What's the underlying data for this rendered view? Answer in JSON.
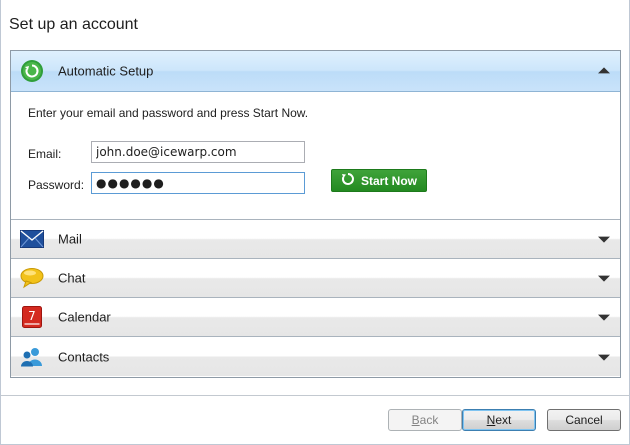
{
  "page_title": "Set up an account",
  "automatic_setup": {
    "label": "Automatic Setup",
    "instructions": "Enter your email and password and press Start Now.",
    "email_label": "Email:",
    "email_value": "john.doe@icewarp.com",
    "password_label": "Password:",
    "password_value": "●●●●●●",
    "start_label": "Start Now"
  },
  "sections": [
    {
      "label": "Mail",
      "icon": "envelope-icon"
    },
    {
      "label": "Chat",
      "icon": "speech-bubble-icon"
    },
    {
      "label": "Calendar",
      "icon": "calendar-icon",
      "day": "7"
    },
    {
      "label": "Contacts",
      "icon": "people-icon"
    }
  ],
  "buttons": {
    "back_prefix": "",
    "back_mnemonic": "B",
    "back_rest": "ack",
    "next_mnemonic": "N",
    "next_rest": "ext",
    "cancel": "Cancel"
  },
  "colors": {
    "accent_green": "#238a21",
    "active_header": "#cde6fb"
  }
}
